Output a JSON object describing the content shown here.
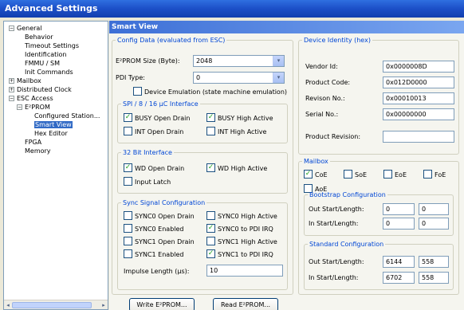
{
  "window": {
    "title": "Advanced Settings"
  },
  "tree": {
    "items": [
      {
        "label": "General",
        "level": 0,
        "expander": "⊟"
      },
      {
        "label": "Behavior",
        "level": 1
      },
      {
        "label": "Timeout Settings",
        "level": 1
      },
      {
        "label": "Identification",
        "level": 1
      },
      {
        "label": "FMMU / SM",
        "level": 1
      },
      {
        "label": "Init Commands",
        "level": 1
      },
      {
        "label": "Mailbox",
        "level": 0,
        "expander": "⊞"
      },
      {
        "label": "Distributed Clock",
        "level": 0,
        "expander": "⊞"
      },
      {
        "label": "ESC Access",
        "level": 0,
        "expander": "⊟"
      },
      {
        "label": "E²PROM",
        "level": 1,
        "expander": "⊟"
      },
      {
        "label": "Configured Station...",
        "level": 2
      },
      {
        "label": "Smart View",
        "level": 2,
        "selected": true
      },
      {
        "label": "Hex Editor",
        "level": 2
      },
      {
        "label": "FPGA",
        "level": 1
      },
      {
        "label": "Memory",
        "level": 1
      }
    ],
    "scroll_left": "◂",
    "scroll_right": "▸"
  },
  "panel": {
    "title": "Smart View",
    "config": {
      "legend": "Config Data (evaluated from ESC)",
      "eeprom_size_label": "E²PROM Size (Byte):",
      "eeprom_size_value": "2048",
      "pdi_type_label": "PDI Type:",
      "pdi_type_value": "0",
      "device_emulation": "Device Emulation (state machine emulation)",
      "spi": {
        "legend": "SPI / 8 / 16 µC Interface",
        "busy_open_drain": "BUSY Open Drain",
        "busy_high_active": "BUSY High Active",
        "int_open_drain": "INT Open Drain",
        "int_high_active": "INT High Active"
      },
      "bit32": {
        "legend": "32 Bit Interface",
        "wd_open_drain": "WD Open Drain",
        "wd_high_active": "WD High Active",
        "input_latch": "Input Latch"
      },
      "sync": {
        "legend": "Sync Signal Configuration",
        "sync0_open_drain": "SYNC0 Open Drain",
        "sync0_high_active": "SYNC0 High Active",
        "sync0_enabled": "SYNC0 Enabled",
        "sync0_to_pdi_irq": "SYNC0 to PDI IRQ",
        "sync1_open_drain": "SYNC1 Open Drain",
        "sync1_high_active": "SYNC1 High Active",
        "sync1_enabled": "SYNC1 Enabled",
        "sync1_to_pdi_irq": "SYNC1 to PDI IRQ",
        "impulse_label": "Impulse Length (µs):",
        "impulse_value": "10"
      }
    },
    "identity": {
      "legend": "Device Identity (hex)",
      "vendor_label": "Vendor Id:",
      "vendor_value": "0x0000008D",
      "product_label": "Product Code:",
      "product_value": "0x012D0000",
      "revision_label": "Revison No.:",
      "revision_value": "0x00010013",
      "serial_label": "Serial No.:",
      "serial_value": "0x00000000",
      "product_revision_label": "Product Revision:",
      "product_revision_value": ""
    },
    "mailbox": {
      "legend": "Mailbox",
      "coe": "CoE",
      "soe": "SoE",
      "eoe": "EoE",
      "foe": "FoE",
      "aoe": "AoE",
      "bootstrap": {
        "legend": "Bootstrap Configuration",
        "out_label": "Out Start/Length:",
        "out_start": "0",
        "out_length": "0",
        "in_label": "In Start/Length:",
        "in_start": "0",
        "in_length": "0"
      },
      "standard": {
        "legend": "Standard Configuration",
        "out_label": "Out Start/Length:",
        "out_start": "6144",
        "out_length": "558",
        "in_label": "In Start/Length:",
        "in_start": "6702",
        "in_length": "558"
      }
    },
    "buttons": {
      "write": "Write E²PROM...",
      "read": "Read E²PROM..."
    },
    "checks": {
      "mark": "✓"
    }
  }
}
